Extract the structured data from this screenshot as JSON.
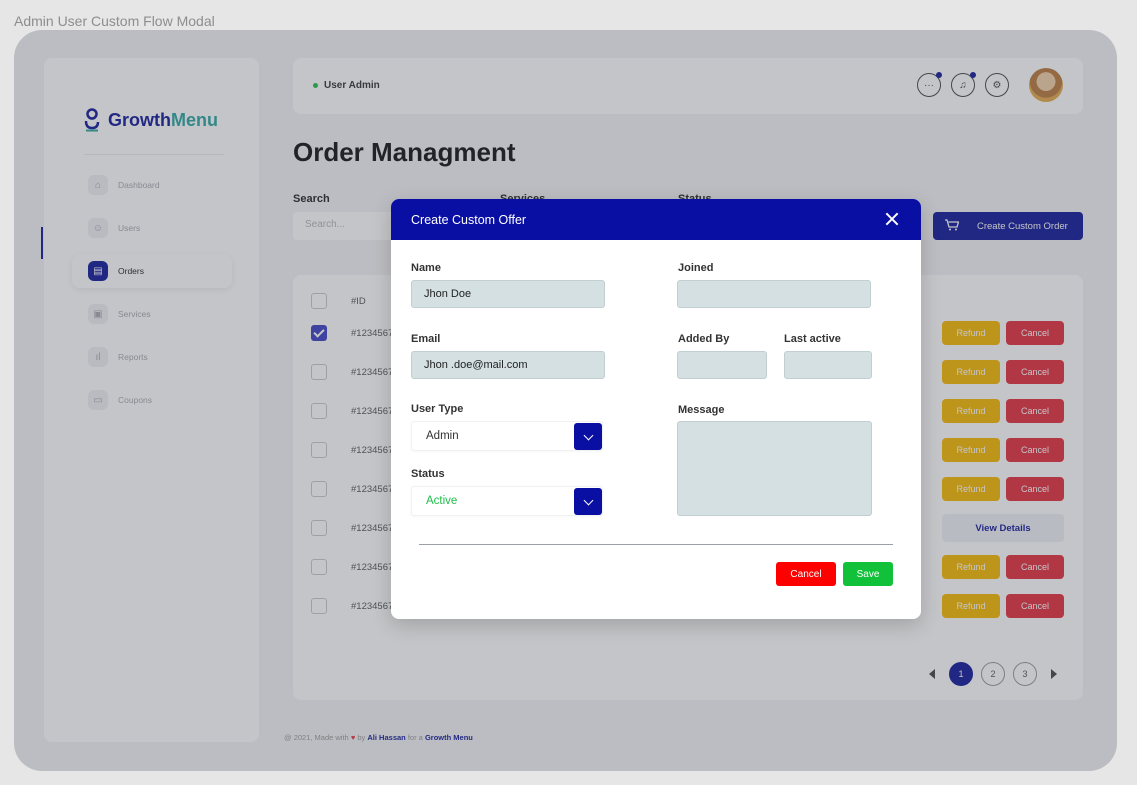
{
  "frame_caption": "Admin User Custom Flow Modal",
  "brand": {
    "name_a": "Growth",
    "name_b": "Menu"
  },
  "sidebar": {
    "items": [
      {
        "label": "Dashboard",
        "icon": "home-icon"
      },
      {
        "label": "Users",
        "icon": "users-icon"
      },
      {
        "label": "Orders",
        "icon": "clipboard-icon",
        "active": true
      },
      {
        "label": "Services",
        "icon": "box-icon"
      },
      {
        "label": "Reports",
        "icon": "chart-icon"
      },
      {
        "label": "Coupons",
        "icon": "coupon-icon"
      }
    ]
  },
  "header": {
    "role": "User Admin"
  },
  "page": {
    "title": "Order Managment"
  },
  "filters": {
    "search_label": "Search",
    "search_placeholder": "Search...",
    "services_label": "Services",
    "status_label": "Status"
  },
  "create_order_label": "Create Custom Order",
  "table": {
    "id_header": "#ID",
    "rows": [
      {
        "id": "#1234567",
        "checked": true,
        "actions": "refund-cancel"
      },
      {
        "id": "#1234567",
        "checked": false,
        "actions": "refund-cancel"
      },
      {
        "id": "#1234567",
        "checked": false,
        "actions": "refund-cancel"
      },
      {
        "id": "#1234567",
        "checked": false,
        "actions": "refund-cancel"
      },
      {
        "id": "#1234567",
        "checked": false,
        "actions": "refund-cancel"
      },
      {
        "id": "#1234567",
        "checked": false,
        "actions": "view"
      },
      {
        "id": "#1234567",
        "checked": false,
        "actions": "refund-cancel"
      },
      {
        "id": "#1234567",
        "checked": false,
        "actions": "refund-cancel"
      }
    ],
    "refund_label": "Refund",
    "cancel_label": "Cancel",
    "view_label": "View Details"
  },
  "pagination": {
    "pages": [
      "1",
      "2",
      "3"
    ],
    "current": "1"
  },
  "footer": {
    "prefix": "@ 2021, Made with",
    "by": "by",
    "author": "Ali Hassan",
    "for": "for a",
    "brand": "Growth Menu"
  },
  "modal": {
    "title": "Create Custom Offer",
    "name_label": "Name",
    "name_value": "Jhon Doe",
    "email_label": "Email",
    "email_value": "Jhon .doe@mail.com",
    "user_type_label": "User Type",
    "user_type_value": "Admin",
    "status_label": "Status",
    "status_value": "Active",
    "joined_label": "Joined",
    "added_by_label": "Added By",
    "last_active_label": "Last active",
    "message_label": "Message",
    "cancel_label": "Cancel",
    "save_label": "Save"
  },
  "colors": {
    "brand": "#10189a",
    "modal_header": "#0a0fa4",
    "refund": "#f5b800",
    "cancel": "#e52e3f",
    "save": "#11c13a",
    "status_active": "#1fbf4a"
  }
}
